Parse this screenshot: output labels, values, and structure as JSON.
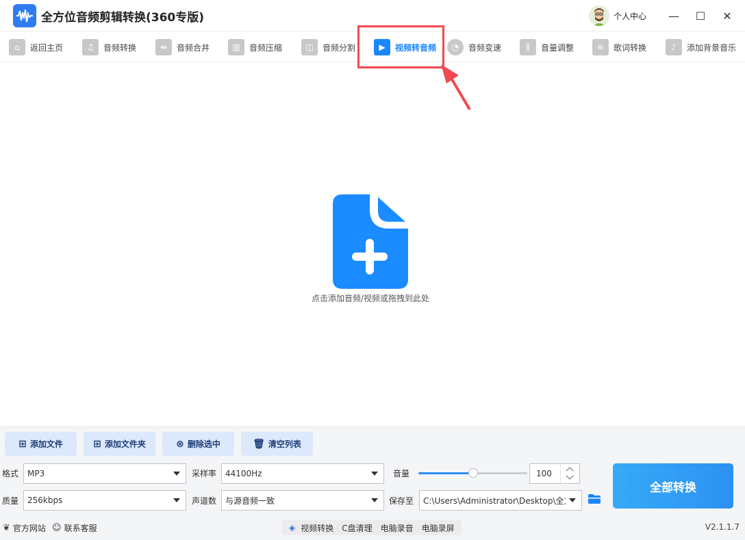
{
  "app": {
    "title": "全方位音频剪辑转换(360专版)",
    "user_center": "个人中心"
  },
  "window_controls": {
    "minimize": "—",
    "maximize": "☐",
    "close": "✕"
  },
  "toolbar": {
    "items": [
      {
        "label": "返回主页",
        "icon": "home-icon",
        "glyph": "⌂"
      },
      {
        "label": "音频转换",
        "icon": "music-note-icon",
        "glyph": "♫"
      },
      {
        "label": "音频合并",
        "icon": "merge-icon",
        "glyph": "⇹"
      },
      {
        "label": "音频压缩",
        "icon": "compress-icon",
        "glyph": "▥"
      },
      {
        "label": "音频分割",
        "icon": "split-icon",
        "glyph": "◫"
      },
      {
        "label": "视频转音频",
        "icon": "video-to-audio-icon",
        "glyph": "▶",
        "active": true
      },
      {
        "label": "音频变速",
        "icon": "speed-gauge-icon",
        "glyph": "◔"
      },
      {
        "label": "音量调整",
        "icon": "equalizer-icon",
        "glyph": "⫼"
      },
      {
        "label": "歌词转换",
        "icon": "lyrics-icon",
        "glyph": "≋"
      },
      {
        "label": "添加背景音乐",
        "icon": "background-music-icon",
        "glyph": "♪"
      }
    ],
    "accent_color": "#1a86ff",
    "highlight_color": "#f04a50"
  },
  "dropzone": {
    "hint": "点击添加音频/视频或拖拽到此处",
    "icon": "file-add-icon",
    "color": "#1a8cff"
  },
  "actions": {
    "add_file": "添加文件",
    "add_folder": "添加文件夹",
    "delete_selected": "删除选中",
    "clear_list": "清空列表"
  },
  "settings": {
    "format_label": "格式",
    "format_value": "MP3",
    "sample_rate_label": "采样率",
    "sample_rate_value": "44100Hz",
    "volume_label": "音量",
    "volume_value": "100",
    "volume_level": 0.5,
    "quality_label": "质量",
    "quality_value": "256kbps",
    "channels_label": "声道数",
    "channels_value": "与源音频一致",
    "save_to_label": "保存至",
    "save_to_value": "C:\\Users\\Administrator\\Desktop\\全方"
  },
  "convert_all": "全部转换",
  "footer": {
    "website": "官方网站",
    "support": "联系客服",
    "links": [
      "视频转换",
      "C盘清理",
      "电脑录音",
      "电脑录屏"
    ],
    "version": "V2.1.1.7"
  }
}
